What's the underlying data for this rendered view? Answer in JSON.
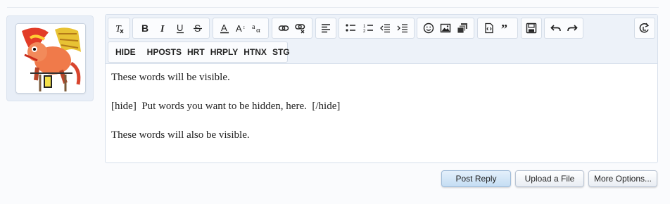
{
  "toolbar": {
    "buttons": [
      {
        "name": "remove-format-icon"
      },
      {
        "name": "bold-icon"
      },
      {
        "name": "italic-icon"
      },
      {
        "name": "underline-icon"
      },
      {
        "name": "strikethrough-icon"
      },
      {
        "name": "text-color-icon"
      },
      {
        "name": "font-size-icon"
      },
      {
        "name": "font-family-icon"
      },
      {
        "name": "link-icon"
      },
      {
        "name": "unlink-icon"
      },
      {
        "name": "align-icon"
      },
      {
        "name": "bullet-list-icon"
      },
      {
        "name": "numbered-list-icon"
      },
      {
        "name": "outdent-icon"
      },
      {
        "name": "indent-icon"
      },
      {
        "name": "smilie-icon"
      },
      {
        "name": "image-icon"
      },
      {
        "name": "media-icon"
      },
      {
        "name": "code-icon"
      },
      {
        "name": "quote-icon"
      },
      {
        "name": "save-draft-icon"
      },
      {
        "name": "undo-icon"
      },
      {
        "name": "redo-icon"
      },
      {
        "name": "toggle-bbcode-icon"
      }
    ],
    "custom_tags": [
      "HIDE",
      "HPOSTS",
      "HRT",
      "HRPLY",
      "HTNX",
      "STG"
    ]
  },
  "editor": {
    "lines": [
      "These words will be visible.",
      "[hide]  Put words you want to be hidden, here.  [/hide]",
      "These words will also be visible."
    ]
  },
  "actions": {
    "post_reply": "Post Reply",
    "upload_file": "Upload a File",
    "more_options": "More Options..."
  },
  "colors": {
    "toolbar_bg": "#edf2f9",
    "border": "#d6dfeb",
    "primary_button": "#c4ddf3"
  }
}
